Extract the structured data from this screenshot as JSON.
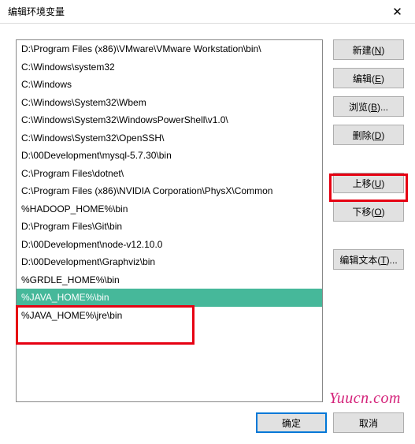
{
  "titlebar": {
    "title": "编辑环境变量"
  },
  "list": {
    "items": [
      "D:\\Program Files (x86)\\VMware\\VMware Workstation\\bin\\",
      "C:\\Windows\\system32",
      "C:\\Windows",
      "C:\\Windows\\System32\\Wbem",
      "C:\\Windows\\System32\\WindowsPowerShell\\v1.0\\",
      "C:\\Windows\\System32\\OpenSSH\\",
      "D:\\00Development\\mysql-5.7.30\\bin",
      "C:\\Program Files\\dotnet\\",
      "C:\\Program Files (x86)\\NVIDIA Corporation\\PhysX\\Common",
      "%HADOOP_HOME%\\bin",
      "D:\\Program Files\\Git\\bin",
      "D:\\00Development\\node-v12.10.0",
      "D:\\00Development\\Graphviz\\bin",
      "%GRDLE_HOME%\\bin",
      "%JAVA_HOME%\\bin",
      "%JAVA_HOME%\\jre\\bin"
    ],
    "selectedIndex": 14
  },
  "buttons": {
    "new": {
      "text": "新建(",
      "u": "N",
      "suffix": ")"
    },
    "edit": {
      "text": "编辑(",
      "u": "E",
      "suffix": ")"
    },
    "browse": {
      "text": "浏览(",
      "u": "B",
      "suffix": ")..."
    },
    "delete": {
      "text": "删除(",
      "u": "D",
      "suffix": ")"
    },
    "moveup": {
      "text": "上移(",
      "u": "U",
      "suffix": ")"
    },
    "movedown": {
      "text": "下移(",
      "u": "O",
      "suffix": ")"
    },
    "edittext": {
      "text": "编辑文本(",
      "u": "T",
      "suffix": ")..."
    },
    "ok": {
      "label": "确定"
    },
    "cancel": {
      "label": "取消"
    }
  },
  "watermark": "Yuucn.com"
}
